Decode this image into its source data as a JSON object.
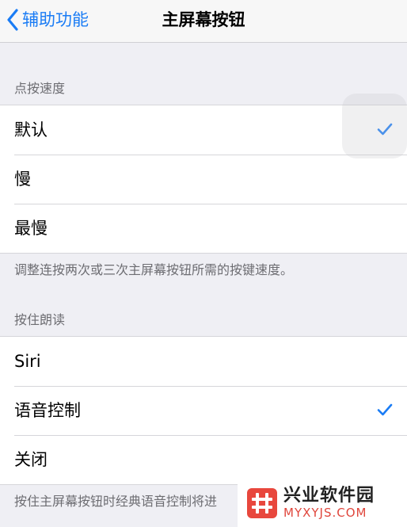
{
  "nav": {
    "back_label": "辅助功能",
    "title": "主屏幕按钮"
  },
  "click_speed": {
    "header": "点按速度",
    "options": [
      {
        "label": "默认",
        "selected": true
      },
      {
        "label": "慢",
        "selected": false
      },
      {
        "label": "最慢",
        "selected": false
      }
    ],
    "footer": "调整连按两次或三次主屏幕按钮所需的按键速度。"
  },
  "press_to_speak": {
    "header": "按住朗读",
    "options": [
      {
        "label": "Siri",
        "selected": false
      },
      {
        "label": "语音控制",
        "selected": true
      },
      {
        "label": "关闭",
        "selected": false
      }
    ],
    "footer": "按住主屏幕按钮时经典语音控制将进"
  },
  "watermark": {
    "name": "兴业软件园",
    "domain": "MYXYJS.COM"
  },
  "colors": {
    "accent": "#1a7cf5",
    "background": "#efeff4",
    "secondary_text": "#6d6d72",
    "watermark_logo": "#e8473d"
  },
  "icons": {
    "back": "chevron-left-icon",
    "check": "checkmark-icon",
    "logo": "hash-logo-icon"
  }
}
